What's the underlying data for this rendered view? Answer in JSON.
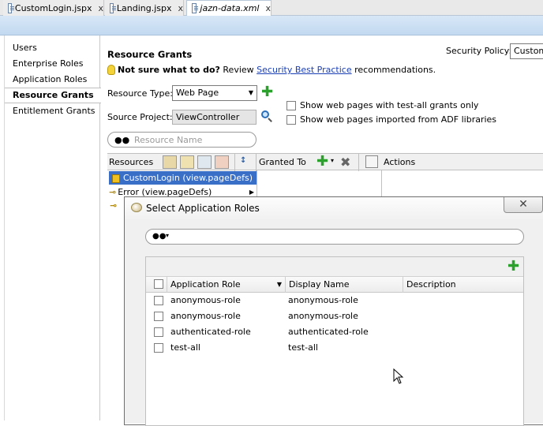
{
  "tabs": [
    {
      "label": "CustomLogin.jspx",
      "close": "x"
    },
    {
      "label": "Landing.jspx",
      "close": "x"
    },
    {
      "label": "jazn-data.xml",
      "close": "x"
    }
  ],
  "leftnav": {
    "items": [
      "Users",
      "Enterprise Roles",
      "Application Roles",
      "Resource Grants",
      "Entitlement Grants"
    ]
  },
  "main": {
    "title": "Resource Grants",
    "hint_prefix": "Not sure what to do?",
    "hint_review": "Review",
    "hint_link": "Security Best Practice",
    "hint_suffix": "recommendations.",
    "security_policy_label": "Security Policy:",
    "security_policy_value": "CustomL",
    "resource_type_label": "Resource Type:",
    "resource_type_value": "Web Page",
    "source_project_label": "Source Project:",
    "source_project_value": "ViewController",
    "show_test_all": "Show web pages with test-all grants only",
    "show_adf": "Show web pages imported from ADF libraries",
    "search_placeholder": "Resource Name"
  },
  "grid": {
    "resources_label": "Resources",
    "granted_to_label": "Granted To",
    "actions_label": "Actions",
    "rows": [
      "CustomLogin (view.pageDefs)",
      "Error (view.pageDefs)"
    ]
  },
  "dialog": {
    "title": "Select Application Roles",
    "close": "✕",
    "columns": {
      "role": "Application Role",
      "display": "Display Name",
      "description": "Description"
    },
    "rows": [
      {
        "role": "anonymous-role",
        "display": "anonymous-role",
        "description": ""
      },
      {
        "role": "anonymous-role",
        "display": "anonymous-role",
        "description": ""
      },
      {
        "role": "authenticated-role",
        "display": "authenticated-role",
        "description": ""
      },
      {
        "role": "test-all",
        "display": "test-all",
        "description": ""
      }
    ]
  },
  "colors": {
    "accent_selection": "#3a6fc8",
    "link": "#1a3fb5",
    "add_green": "#2aa12a"
  }
}
